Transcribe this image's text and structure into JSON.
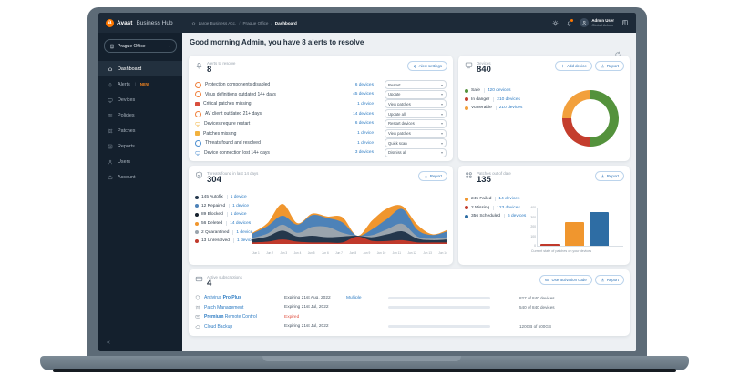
{
  "topbar": {
    "logo_bold": "Avast",
    "logo_rest": "Business Hub",
    "breadcrumb": [
      "Large Business Acc.",
      "Prague Office",
      "Dashboard"
    ],
    "user": {
      "name": "Admin User",
      "role": "Global Admin"
    }
  },
  "sidebar": {
    "org_selector": "Prague Office",
    "items": [
      {
        "label": "Dashboard",
        "icon": "home",
        "active": true
      },
      {
        "label": "Alerts",
        "icon": "bell",
        "badge": "NEW"
      },
      {
        "label": "Devices",
        "icon": "monitor"
      },
      {
        "label": "Policies",
        "icon": "sliders"
      },
      {
        "label": "Patches",
        "icon": "patches"
      },
      {
        "label": "Reports",
        "icon": "report"
      },
      {
        "label": "Users",
        "icon": "person"
      },
      {
        "label": "Account",
        "icon": "briefcase"
      }
    ],
    "collapse_icon": "«"
  },
  "header": {
    "greeting": "Good morning Admin, you have 8 alerts to resolve"
  },
  "alerts_card": {
    "title": "Alerts to resolve",
    "count": "8",
    "settings_button": "Alert settings",
    "rows": [
      {
        "label": "Protection components disabled",
        "devices": "6 devices",
        "action": "Restart",
        "icon": "ring",
        "color": "#f0803c"
      },
      {
        "label": "Virus definitions outdated 14+ days",
        "devices": "45 devices",
        "action": "Update",
        "icon": "ring",
        "color": "#f0803c"
      },
      {
        "label": "Critical patches missing",
        "devices": "1 device",
        "action": "View patches",
        "icon": "square",
        "color": "#d94f3d"
      },
      {
        "label": "AV client outdated 21+ days",
        "devices": "14 devices",
        "action": "Update all",
        "icon": "ring",
        "color": "#f0803c"
      },
      {
        "label": "Devices require restart",
        "devices": "6 devices",
        "action": "Restart devices",
        "icon": "monitor",
        "color": "#f2b23e"
      },
      {
        "label": "Patches missing",
        "devices": "1 device",
        "action": "View patches",
        "icon": "square",
        "color": "#f2b23e"
      },
      {
        "label": "Threats found and resolved",
        "devices": "1 device",
        "action": "Quick scan",
        "icon": "ring",
        "color": "#4d8fd1"
      },
      {
        "label": "Device connection lost 14+ days",
        "devices": "3 devices",
        "action": "Dismiss all",
        "icon": "monitor",
        "color": "#4d8fd1"
      }
    ]
  },
  "devices_card": {
    "title": "Devices",
    "count": "840",
    "add_button": "Add device",
    "report_button": "Report",
    "legend": [
      {
        "label": "Safe",
        "value": "420 devices",
        "color": "#54923c"
      },
      {
        "label": "In danger",
        "value": "210 devices",
        "color": "#c43d2d"
      },
      {
        "label": "Vulnerable",
        "value": "210 devices",
        "color": "#f2a03c"
      }
    ],
    "chart_data": {
      "type": "pie",
      "donut": true,
      "total": 840,
      "segments": [
        {
          "label": "Safe",
          "value": 420,
          "color": "#54923c"
        },
        {
          "label": "In danger",
          "value": 210,
          "color": "#c43d2d"
        },
        {
          "label": "Vulnerable",
          "value": 210,
          "color": "#f2a03c"
        }
      ]
    }
  },
  "threats_card": {
    "title": "Threats found in last 14 days",
    "count": "304",
    "report_button": "Report",
    "legend": [
      {
        "count": "145",
        "label": "Autofix",
        "value": "1 device",
        "color": "#24374c"
      },
      {
        "count": "12",
        "label": "Repaired",
        "value": "1 device",
        "color": "#4d82b8"
      },
      {
        "count": "89",
        "label": "Blocked",
        "value": "1 device",
        "color": "#16222e"
      },
      {
        "count": "56",
        "label": "Deleted",
        "value": "14 devices",
        "color": "#f0962e"
      },
      {
        "count": "2",
        "label": "Quarantined",
        "value": "1 device",
        "color": "#9aa4ad"
      },
      {
        "count": "13",
        "label": "Unresolved",
        "value": "1 device",
        "color": "#c0392b"
      }
    ],
    "chart_data": {
      "type": "area",
      "stacked": true,
      "x": [
        "Jun 1",
        "Jun 2",
        "Jun 3",
        "Jun 4",
        "Jun 5",
        "Jun 6",
        "Jun 7",
        "Jun 8",
        "Jun 9",
        "Jun 10",
        "Jun 11",
        "Jun 12",
        "Jun 13",
        "Jun 14"
      ],
      "series": [
        {
          "name": "Unresolved",
          "color": "#c0392b",
          "values": [
            2,
            3,
            6,
            3,
            2,
            2,
            2,
            10,
            4,
            4,
            5,
            2,
            2,
            2
          ]
        },
        {
          "name": "Autofix",
          "color": "#24374c",
          "values": [
            4,
            7,
            12,
            7,
            9,
            7,
            8,
            1,
            5,
            9,
            12,
            5,
            3,
            4
          ]
        },
        {
          "name": "Quarantined",
          "color": "#9aa4ad",
          "values": [
            2,
            4,
            8,
            5,
            12,
            14,
            5,
            0,
            3,
            7,
            10,
            3,
            2,
            3
          ]
        },
        {
          "name": "Blocked",
          "color": "#4d82b8",
          "values": [
            6,
            10,
            12,
            11,
            16,
            12,
            14,
            0,
            8,
            14,
            20,
            9,
            5,
            8
          ]
        },
        {
          "name": "Deleted",
          "color": "#f0962e",
          "values": [
            1,
            4,
            16,
            2,
            2,
            2,
            7,
            0,
            12,
            14,
            4,
            7,
            1,
            2
          ]
        }
      ]
    }
  },
  "patches_card": {
    "title": "Patches out of date",
    "count": "135",
    "report_button": "Report",
    "legend": [
      {
        "count": "245",
        "label": "Failed",
        "value": "14 devices",
        "color": "#f0962e"
      },
      {
        "count": "2",
        "label": "Missing",
        "value": "123 devices",
        "color": "#c0392b"
      },
      {
        "count": "356",
        "label": "Scheduled",
        "value": "6 devices",
        "color": "#2e6da4"
      }
    ],
    "chart_data": {
      "type": "bar",
      "categories": [
        "Missing",
        "Failed",
        "Scheduled"
      ],
      "values": [
        20,
        245,
        356
      ],
      "colors": [
        "#c0392b",
        "#f0962e",
        "#2e6da4"
      ],
      "yticks": [
        0,
        100,
        200,
        300,
        400
      ],
      "ylim": [
        0,
        400
      ],
      "caption": "Current state of patches on your devices"
    }
  },
  "subscriptions_card": {
    "title": "Active subscriptions",
    "count": "4",
    "activation_button": "Use activation code",
    "report_button": "Report",
    "rows": [
      {
        "icon": "shield",
        "name_parts": [
          {
            "t": "Antivirus "
          },
          {
            "t": "Pro Plus",
            "b": true
          }
        ],
        "expiry": "Expiring 21st Aug, 2022",
        "expired": false,
        "extra": "Multiple",
        "progress": 97,
        "usage": "827 of 840 devices"
      },
      {
        "icon": "patches",
        "name_parts": [
          {
            "t": "Patch Management"
          }
        ],
        "expiry": "Expiring 21st Jul, 2022",
        "expired": false,
        "extra": "",
        "progress": 62,
        "usage": "540 of 840 devices"
      },
      {
        "icon": "remote",
        "name_parts": [
          {
            "t": "Premium",
            "b": true
          },
          {
            "t": " Remote Control"
          }
        ],
        "expiry": "Expired",
        "expired": true,
        "extra": "",
        "progress": null,
        "usage": ""
      },
      {
        "icon": "cloud",
        "name_parts": [
          {
            "t": "Cloud Backup"
          }
        ],
        "expiry": "Expiring 21st Jul, 2022",
        "expired": false,
        "extra": "",
        "progress": 62,
        "usage": "120GB of 500GB"
      }
    ]
  }
}
